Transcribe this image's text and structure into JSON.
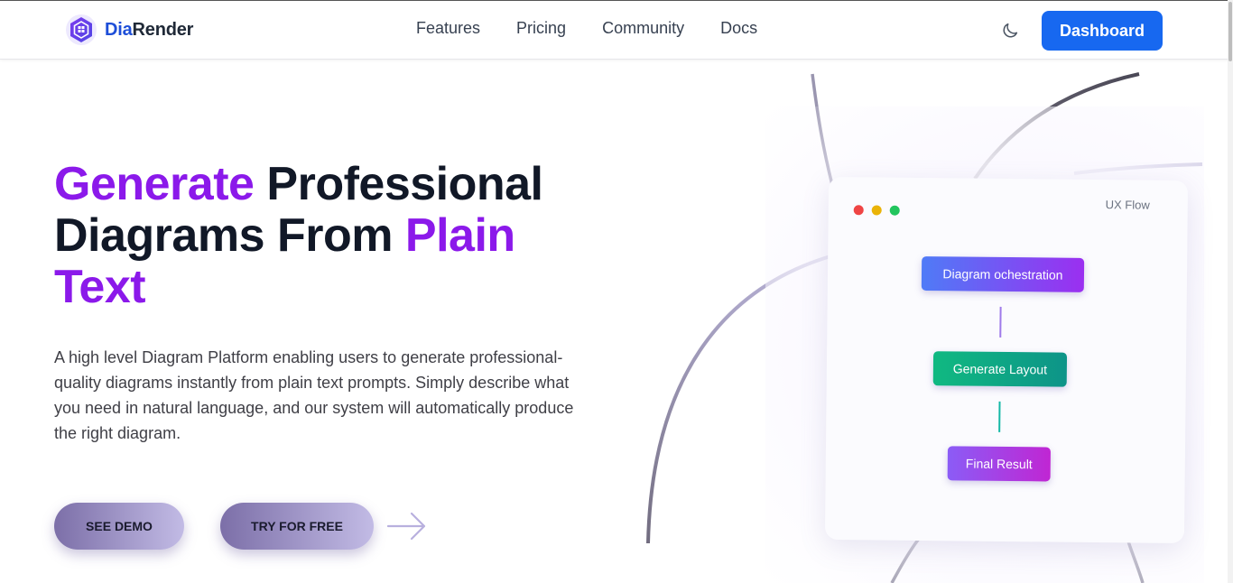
{
  "brand": {
    "name_prefix": "Dia",
    "name_suffix": "Render"
  },
  "nav": {
    "links": [
      "Features",
      "Pricing",
      "Community",
      "Docs"
    ],
    "theme_toggle_icon": "moon-icon",
    "dashboard_label": "Dashboard"
  },
  "hero": {
    "headline": {
      "word1": "Generate",
      "word2": " Professional Diagrams From ",
      "word3": "Plain Text"
    },
    "description": "A high level Diagram Platform enabling users to generate professional-quality diagrams instantly from plain text prompts. Simply describe what you need in natural language, and our system will automatically produce the right diagram.",
    "cta_demo": "SEE DEMO",
    "cta_free": "TRY FOR FREE",
    "cta_arrow_icon": "arrow-right-icon"
  },
  "preview": {
    "label": "UX Flow",
    "nodes": [
      "Diagram ochestration",
      "Generate Layout",
      "Final Result"
    ]
  },
  "colors": {
    "accent_purple": "#8b19ea",
    "brand_blue": "#1d4ed8",
    "dashboard_button": "#1768f0",
    "heading": "#111827"
  }
}
